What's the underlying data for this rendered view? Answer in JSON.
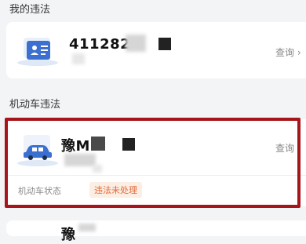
{
  "my_violations": {
    "section_title": "我的违法",
    "license_number": "411282*",
    "query_label": "查询 ›"
  },
  "vehicle_violations": {
    "section_title": "机动车违法",
    "plate": "豫M",
    "query_label": "查询 ›",
    "status_label": "机动车状态",
    "status_badge": "违法未处理"
  },
  "next_item": {
    "plate_partial": "豫"
  },
  "colors": {
    "highlight_border": "#a5151b",
    "badge_text": "#e26b3a",
    "badge_bg": "#fdeee3",
    "icon_blue": "#3b6fd0"
  },
  "icons": {
    "license": "id-card-icon",
    "vehicle": "car-icon"
  }
}
